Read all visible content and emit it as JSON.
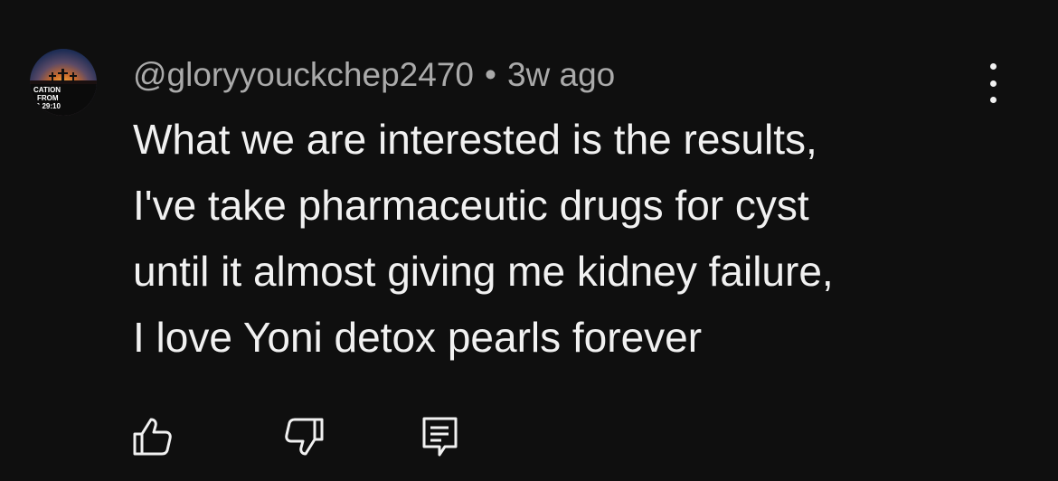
{
  "comment": {
    "avatar": {
      "icon": "avatar-sunset-crosses",
      "text_line1": "CATION",
      "text_line2": "FROM",
      "text_line3": "'S 29:10"
    },
    "author": "@gloryyouckchep2470",
    "separator": "•",
    "time": "3w ago",
    "lines": [
      "What we are interested is the results,",
      "I've take pharmaceutic drugs for cyst",
      "until it almost giving me kidney failure,",
      "I love Yoni detox pearls forever"
    ],
    "actions": {
      "like_icon": "thumbs-up-icon",
      "dislike_icon": "thumbs-down-icon",
      "reply_icon": "reply-icon",
      "menu_icon": "more-vert-icon"
    }
  },
  "colors": {
    "background": "#0f0f0f",
    "text": "#f1f1f1",
    "meta_text": "#aaaaaa"
  }
}
